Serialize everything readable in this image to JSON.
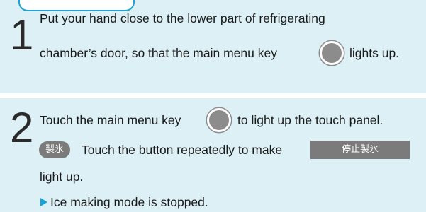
{
  "step1": {
    "number": "1",
    "line1": "Put your hand close to the lower part of refrigerating",
    "line2_before": "chamber’s door, so that the main menu key",
    "line2_after": "lights up."
  },
  "step2": {
    "number": "2",
    "line1_before": "Touch the main menu key",
    "line1_after": "to light up the touch panel.",
    "ice_button_label": "製氷",
    "line2_text": "Touch the button repeatedly to make",
    "stop_button_label": "停止製氷",
    "line3": "light up.",
    "result": "Ice making mode is stopped."
  },
  "colors": {
    "background": "#dcf0f6",
    "accent": "#1aa3d6",
    "button_gray": "#7b7b7b"
  }
}
